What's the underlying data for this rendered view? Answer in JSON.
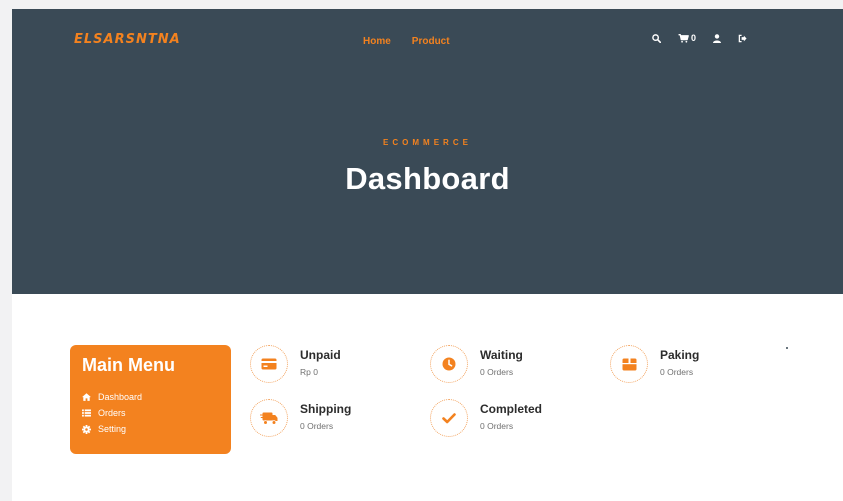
{
  "brand": {
    "logo_text": "ELSARSNTNA",
    "accent": "#f3821f",
    "hero_bg": "#3a4a56"
  },
  "nav": {
    "items": [
      {
        "label": "Home"
      },
      {
        "label": "Product"
      }
    ]
  },
  "header_tools": {
    "search_icon": "search-icon",
    "cart_icon": "cart-icon",
    "cart_count": "0",
    "user_icon": "user-icon",
    "logout_icon": "logout-icon"
  },
  "hero": {
    "eyebrow": "ECOMMERCE",
    "title": "Dashboard"
  },
  "sidebar": {
    "title": "Main Menu",
    "items": [
      {
        "label": "Dashboard",
        "icon": "home-icon"
      },
      {
        "label": "Orders",
        "icon": "list-icon"
      },
      {
        "label": "Setting",
        "icon": "gear-icon"
      }
    ]
  },
  "stats": [
    {
      "label": "Unpaid",
      "value": "Rp 0",
      "icon": "credit-card-icon"
    },
    {
      "label": "Waiting",
      "value": "0 Orders",
      "icon": "clock-icon"
    },
    {
      "label": "Paking",
      "value": "0 Orders",
      "icon": "box-icon"
    },
    {
      "label": "Shipping",
      "value": "0 Orders",
      "icon": "truck-icon"
    },
    {
      "label": "Completed",
      "value": "0 Orders",
      "icon": "check-icon"
    }
  ]
}
